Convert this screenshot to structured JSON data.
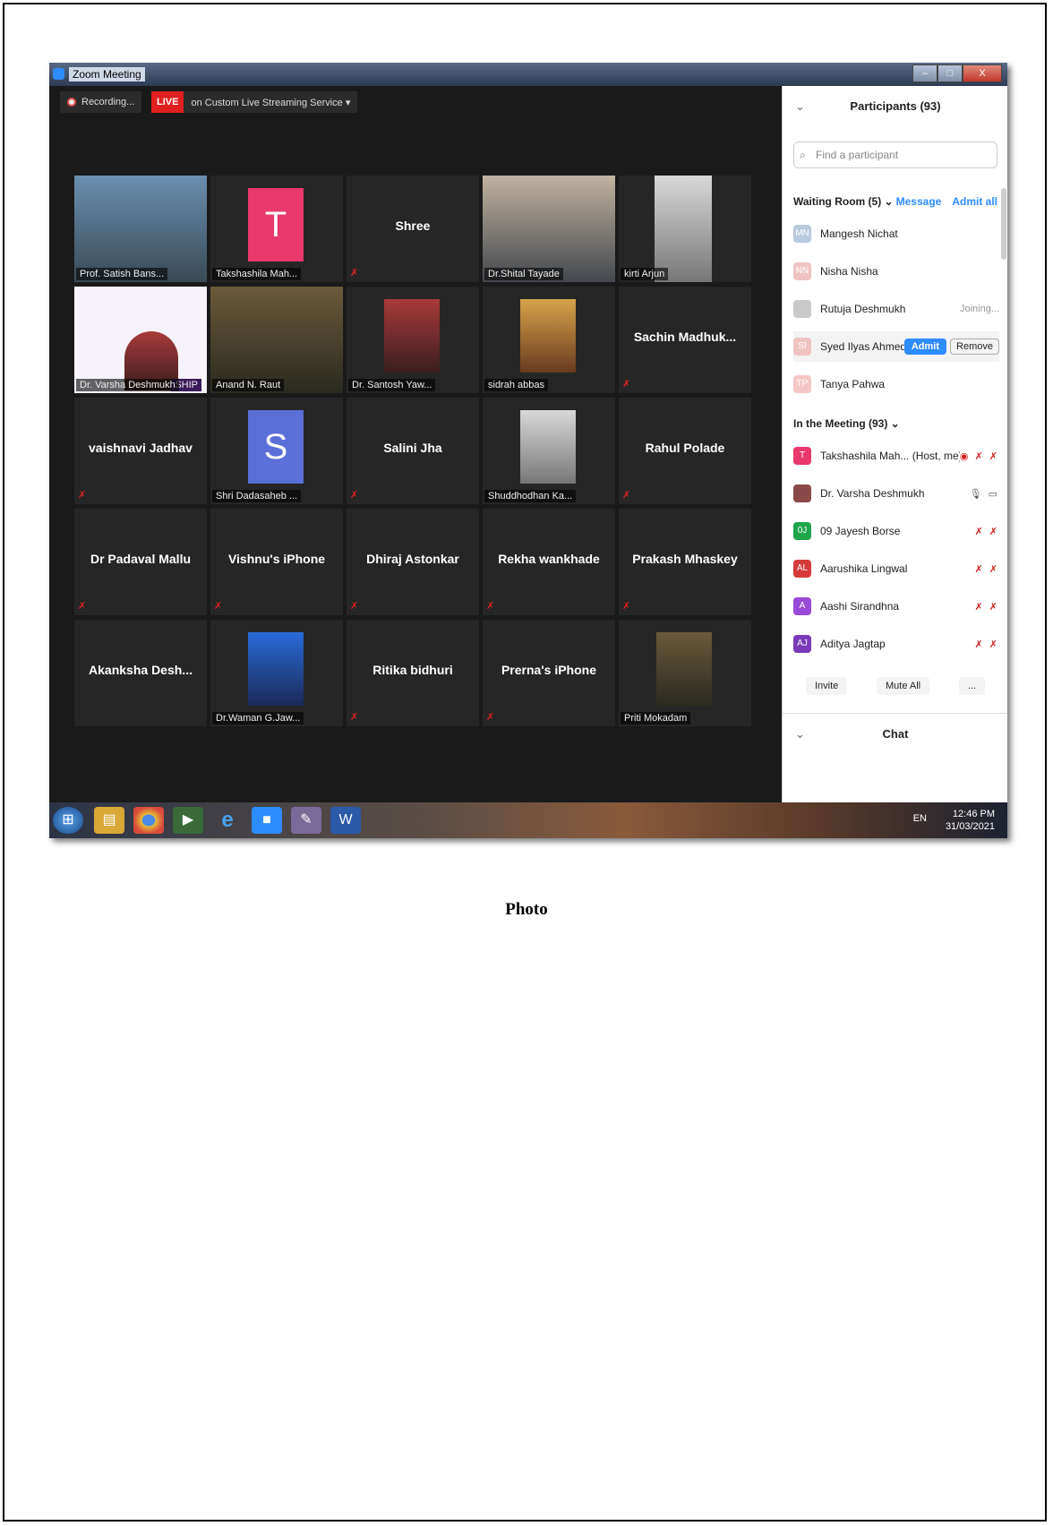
{
  "window": {
    "title": "Zoom Meeting",
    "min": "–",
    "max": "□",
    "close": "X"
  },
  "recording": {
    "label": "Recording..."
  },
  "live": {
    "tag": "LIVE",
    "text": "on Custom Live Streaming Service ▾"
  },
  "tiles": [
    {
      "label": "Prof. Satish Bans...",
      "kind": "photo"
    },
    {
      "label": "Takshashila Mah...",
      "kind": "avatar",
      "letter": "T",
      "color": "#e8386c"
    },
    {
      "name": "Shree",
      "kind": "name"
    },
    {
      "label": "Dr.Shital Tayade",
      "kind": "photo"
    },
    {
      "label": "kirti Arjun",
      "kind": "photo"
    },
    {
      "label": "Dr. Varsha Deshmukh",
      "kind": "banner",
      "banner_text": "SHIP"
    },
    {
      "label": "Anand N. Raut",
      "kind": "photo"
    },
    {
      "label": "Dr. Santosh Yaw...",
      "kind": "photo"
    },
    {
      "label": "sidrah abbas",
      "kind": "photo"
    },
    {
      "name": "Sachin Madhuk...",
      "kind": "name"
    },
    {
      "name": "vaishnavi Jadhav",
      "kind": "name"
    },
    {
      "label": "Shri Dadasaheb ...",
      "kind": "avatar",
      "letter": "S",
      "color": "#5a6fd8"
    },
    {
      "name": "Salini Jha",
      "kind": "name"
    },
    {
      "label": "Shuddhodhan Ka...",
      "kind": "photo"
    },
    {
      "name": "Rahul Polade",
      "kind": "name"
    },
    {
      "name": "Dr Padaval Mallu",
      "kind": "name"
    },
    {
      "name": "Vishnu's iPhone",
      "kind": "name"
    },
    {
      "name": "Dhiraj Astonkar",
      "kind": "name"
    },
    {
      "name": "Rekha wankhade",
      "kind": "name"
    },
    {
      "name": "Prakash Mhaskey",
      "kind": "name"
    },
    {
      "name": "Akanksha Desh...",
      "kind": "name"
    },
    {
      "label": "Dr.Waman G.Jaw...",
      "kind": "photo"
    },
    {
      "name": "Ritika bidhuri",
      "kind": "name"
    },
    {
      "name": "Prerna's iPhone",
      "kind": "name"
    },
    {
      "label": "Priti Mokadam",
      "kind": "photo"
    }
  ],
  "panel": {
    "title": "Participants (93)",
    "search_placeholder": "Find a participant",
    "waiting_room": {
      "label": "Waiting Room (5) ⌄",
      "message": "Message",
      "admit_all": "Admit all",
      "people": [
        {
          "initials": "MN",
          "name": "Mangesh Nichat",
          "color": "#b9c9de"
        },
        {
          "initials": "NN",
          "name": "Nisha Nisha",
          "color": "#f0c3c3"
        },
        {
          "initials": "",
          "name": "Rutuja Deshmukh",
          "color": "#c9c9c9",
          "status": "Joining..."
        },
        {
          "initials": "SI",
          "name": "Syed Ilyas Ahmed",
          "color": "#f0c3c3",
          "admit": "Admit",
          "remove": "Remove"
        },
        {
          "initials": "TP",
          "name": "Tanya Pahwa",
          "color": "#f5c6c6"
        }
      ]
    },
    "in_meeting": {
      "label": "In the Meeting (93) ⌄",
      "people": [
        {
          "initials": "T",
          "name": "Takshashila Mah... (Host, me)",
          "color": "#e8386c",
          "status": "◉ ✗ ✗"
        },
        {
          "initials": "",
          "name": "Dr. Varsha Deshmukh",
          "color": "#8a4a4a",
          "status": "🎙 ▭"
        },
        {
          "initials": "0J",
          "name": "09 Jayesh Borse",
          "color": "#1fa64b",
          "status": "✗ ✗"
        },
        {
          "initials": "AL",
          "name": "Aarushika Lingwal",
          "color": "#d63a3a",
          "status": "✗ ✗"
        },
        {
          "initials": "A",
          "name": "Aashi Sirandhna",
          "color": "#9a4ad8",
          "status": "✗ ✗"
        },
        {
          "initials": "AJ",
          "name": "Aditya Jagtap",
          "color": "#7a3ab8",
          "status": "✗ ✗"
        }
      ]
    },
    "buttons": {
      "invite": "Invite",
      "mute_all": "Mute All",
      "more": "..."
    },
    "chat": "Chat"
  },
  "taskbar": {
    "lang": "EN",
    "time": "12:46 PM",
    "date": "31/03/2021"
  },
  "caption": "Photo"
}
